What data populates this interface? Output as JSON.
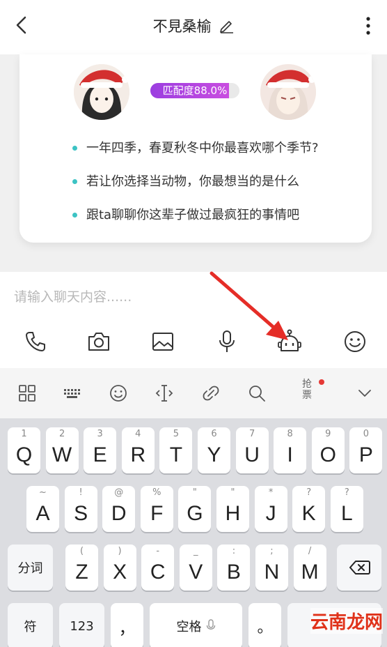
{
  "header": {
    "title": "不見桑榆",
    "back_icon": "chevron-left-icon",
    "edit_icon": "pencil-icon",
    "more_icon": "vertical-dots-icon"
  },
  "match_card": {
    "match_label": "匹配度88.0%",
    "match_fraction": 0.88,
    "accent_color": "#9b3ee0",
    "topics": [
      "一年四季，春夏秋冬中你最喜欢哪个季节?",
      "若让你选择当动物，你最想当的是什么",
      "跟ta聊聊你这辈子做过最疯狂的事情吧"
    ],
    "bullet_color": "#3cc3c4"
  },
  "input": {
    "placeholder": "请输入聊天内容......",
    "value": ""
  },
  "toolbar": {
    "icons": [
      "phone-icon",
      "camera-icon",
      "image-icon",
      "microphone-icon",
      "robot-icon",
      "emoji-icon"
    ]
  },
  "keyboard_toolbar": {
    "icons": [
      "grid-icon",
      "keyboard-icon",
      "smiley-icon",
      "cursor-icon",
      "link-icon",
      "search-icon",
      "ticket-text",
      "chevron-down-icon"
    ],
    "ticket_text": "抢票"
  },
  "keyboard": {
    "row1": [
      {
        "hint": "1",
        "key": "Q"
      },
      {
        "hint": "2",
        "key": "W"
      },
      {
        "hint": "3",
        "key": "E"
      },
      {
        "hint": "4",
        "key": "R"
      },
      {
        "hint": "5",
        "key": "T"
      },
      {
        "hint": "6",
        "key": "Y"
      },
      {
        "hint": "7",
        "key": "U"
      },
      {
        "hint": "8",
        "key": "I"
      },
      {
        "hint": "9",
        "key": "O"
      },
      {
        "hint": "0",
        "key": "P"
      }
    ],
    "row2": [
      {
        "hint": "~",
        "key": "A"
      },
      {
        "hint": "!",
        "key": "S"
      },
      {
        "hint": "@",
        "key": "D"
      },
      {
        "hint": "%",
        "key": "F"
      },
      {
        "hint": "\"",
        "key": "G"
      },
      {
        "hint": "\"",
        "key": "H"
      },
      {
        "hint": "*",
        "key": "J"
      },
      {
        "hint": "?",
        "key": "K"
      },
      {
        "hint": "?",
        "key": "L"
      }
    ],
    "row3": [
      {
        "hint": "(",
        "key": "Z"
      },
      {
        "hint": ")",
        "key": "X"
      },
      {
        "hint": "-",
        "key": "C"
      },
      {
        "hint": "_",
        "key": "V"
      },
      {
        "hint": ":",
        "key": "B"
      },
      {
        "hint": ";",
        "key": "N"
      },
      {
        "hint": "/",
        "key": "M"
      }
    ],
    "segment_label": "分词",
    "symbol_label": "符",
    "number_label": "123",
    "comma_label": "，",
    "space_label": "空格",
    "period_label": "。"
  },
  "watermark": "云南龙网"
}
